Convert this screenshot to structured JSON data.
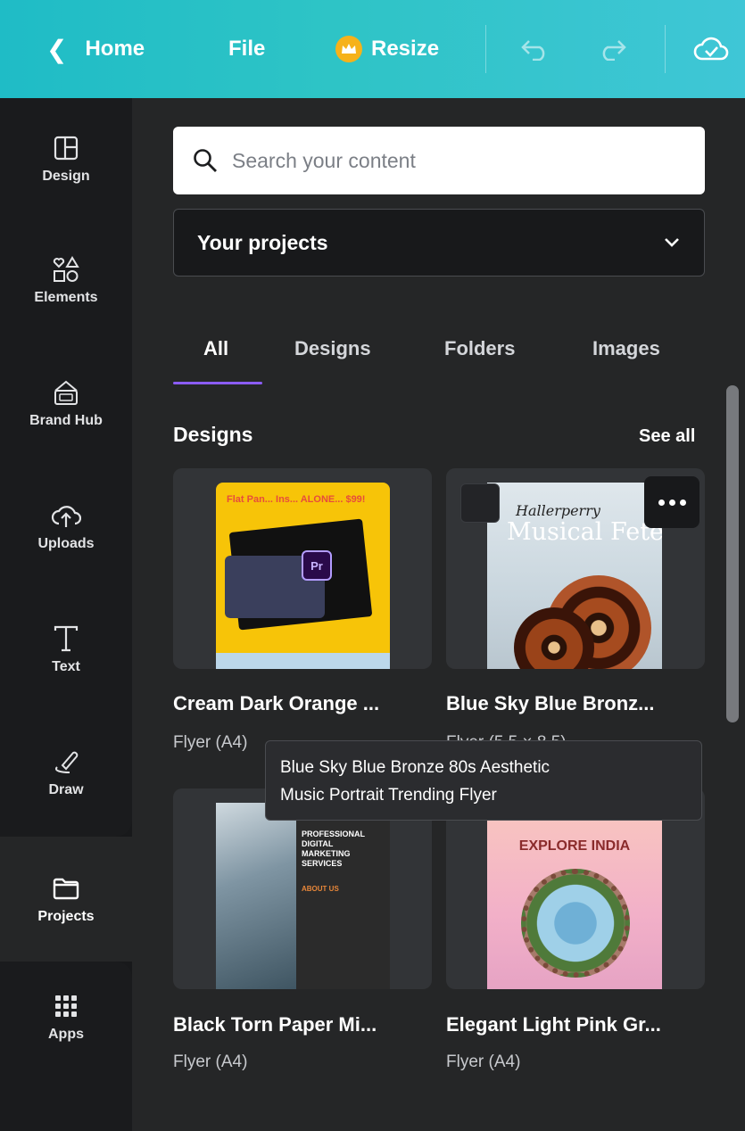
{
  "topbar": {
    "home_label": "Home",
    "file_label": "File",
    "resize_label": "Resize"
  },
  "rail": {
    "items": [
      {
        "label": "Design",
        "icon": "layout-icon"
      },
      {
        "label": "Elements",
        "icon": "shapes-icon"
      },
      {
        "label": "Brand Hub",
        "icon": "brand-hub-icon"
      },
      {
        "label": "Uploads",
        "icon": "cloud-upload-icon"
      },
      {
        "label": "Text",
        "icon": "text-icon"
      },
      {
        "label": "Draw",
        "icon": "draw-icon"
      },
      {
        "label": "Projects",
        "icon": "folder-icon"
      },
      {
        "label": "Apps",
        "icon": "apps-grid-icon"
      }
    ]
  },
  "search": {
    "placeholder": "Search your content"
  },
  "filter": {
    "selected": "Your projects"
  },
  "tabs": [
    {
      "label": "All",
      "active": true
    },
    {
      "label": "Designs"
    },
    {
      "label": "Folders"
    },
    {
      "label": "Images"
    }
  ],
  "designs_section": {
    "title": "Designs",
    "see_all": "See all"
  },
  "cards": [
    {
      "title": "Cream Dark Orange ...",
      "subtitle": "Flyer (A4)",
      "thumb_text": "Flat Pan... Ins... ALONE... $99!"
    },
    {
      "title": "Blue Sky Blue Bronz...",
      "subtitle": "Flyer (5.5 × 8.5)",
      "thumb_script": "Hallerperry",
      "thumb_heading": "Musical Fete"
    },
    {
      "title": "Black Torn Paper Mi...",
      "subtitle": "Flyer (A4)",
      "thumb_heading": "PROFESSIONAL DIGITAL MARKETING SERVICES",
      "thumb_sub": "ABOUT US"
    },
    {
      "title": "Elegant Light Pink Gr...",
      "subtitle": "Flyer (A4)",
      "thumb_heading": "EXPLORE INDIA"
    }
  ],
  "tooltip": {
    "line1": "Blue Sky Blue Bronze 80s Aesthetic",
    "line2": "Music Portrait Trending Flyer"
  },
  "colors": {
    "accent": "#8b5cf6",
    "topbar": "#2ec4c6",
    "crown": "#f6b21a"
  }
}
